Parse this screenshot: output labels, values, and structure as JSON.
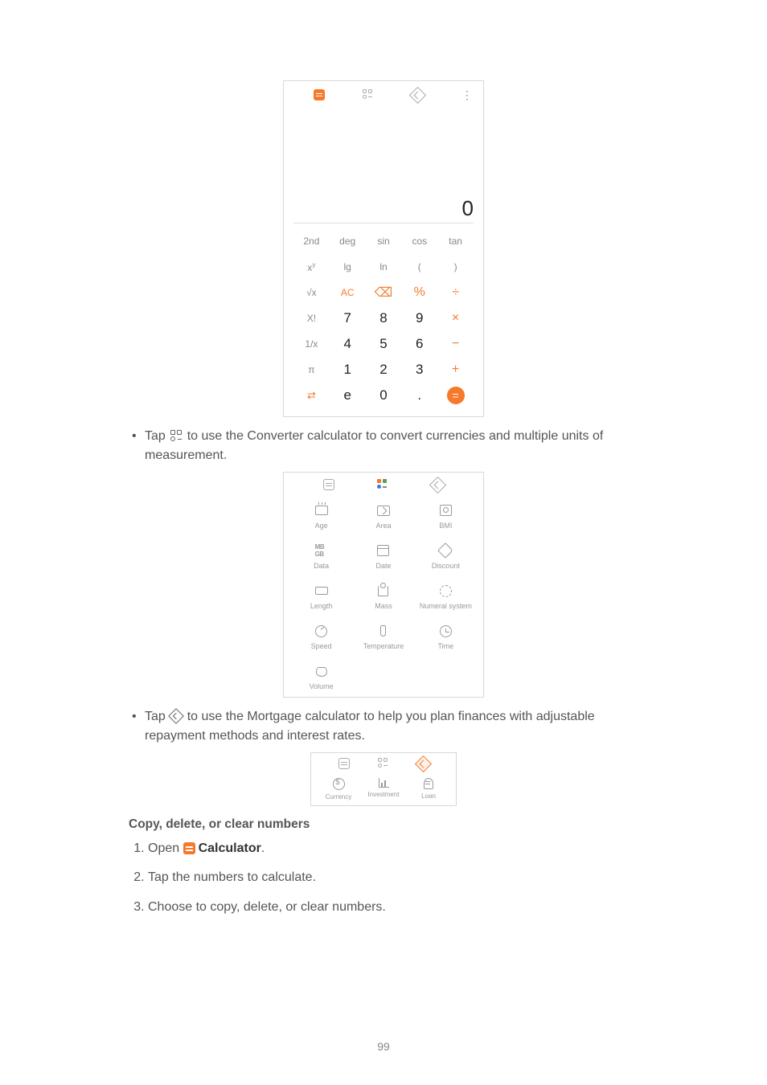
{
  "scientific": {
    "display": "0",
    "rows": [
      [
        "2nd",
        "deg",
        "sin",
        "cos",
        "tan"
      ],
      [
        "xʸ",
        "lg",
        "ln",
        "(",
        ")"
      ],
      [
        "√x",
        "AC",
        "⌫",
        "%",
        "÷"
      ],
      [
        "X!",
        "7",
        "8",
        "9",
        "×"
      ],
      [
        "1/x",
        "4",
        "5",
        "6",
        "−"
      ],
      [
        "π",
        "1",
        "2",
        "3",
        "+"
      ],
      [
        "⇄",
        "e",
        "0",
        ".",
        "="
      ]
    ]
  },
  "bullet1_a": "Tap ",
  "bullet1_b": " to use the Converter calculator to convert currencies and multiple units of measurement.",
  "converterItems": [
    {
      "label": "Age"
    },
    {
      "label": "Area"
    },
    {
      "label": "BMI"
    },
    {
      "label": "Data"
    },
    {
      "label": "Date"
    },
    {
      "label": "Discount"
    },
    {
      "label": "Length"
    },
    {
      "label": "Mass"
    },
    {
      "label": "Numeral system"
    },
    {
      "label": "Speed"
    },
    {
      "label": "Temperature"
    },
    {
      "label": "Time"
    },
    {
      "label": "Volume"
    }
  ],
  "bullet2_a": "Tap ",
  "bullet2_b": " to use the Mortgage calculator to help you plan finances with adjustable repayment methods and interest rates.",
  "mortgageItems": [
    {
      "label": "Currency"
    },
    {
      "label": "Investment"
    },
    {
      "label": "Loan"
    }
  ],
  "sectionTitle": "Copy, delete, or clear numbers",
  "steps": {
    "s1a": "Open ",
    "s1b": "Calculator",
    "s1c": ".",
    "s2": "Tap the numbers to calculate.",
    "s3": "Choose to copy, delete, or clear numbers."
  },
  "dataLabel": "MB GB",
  "pageNumber": "99"
}
